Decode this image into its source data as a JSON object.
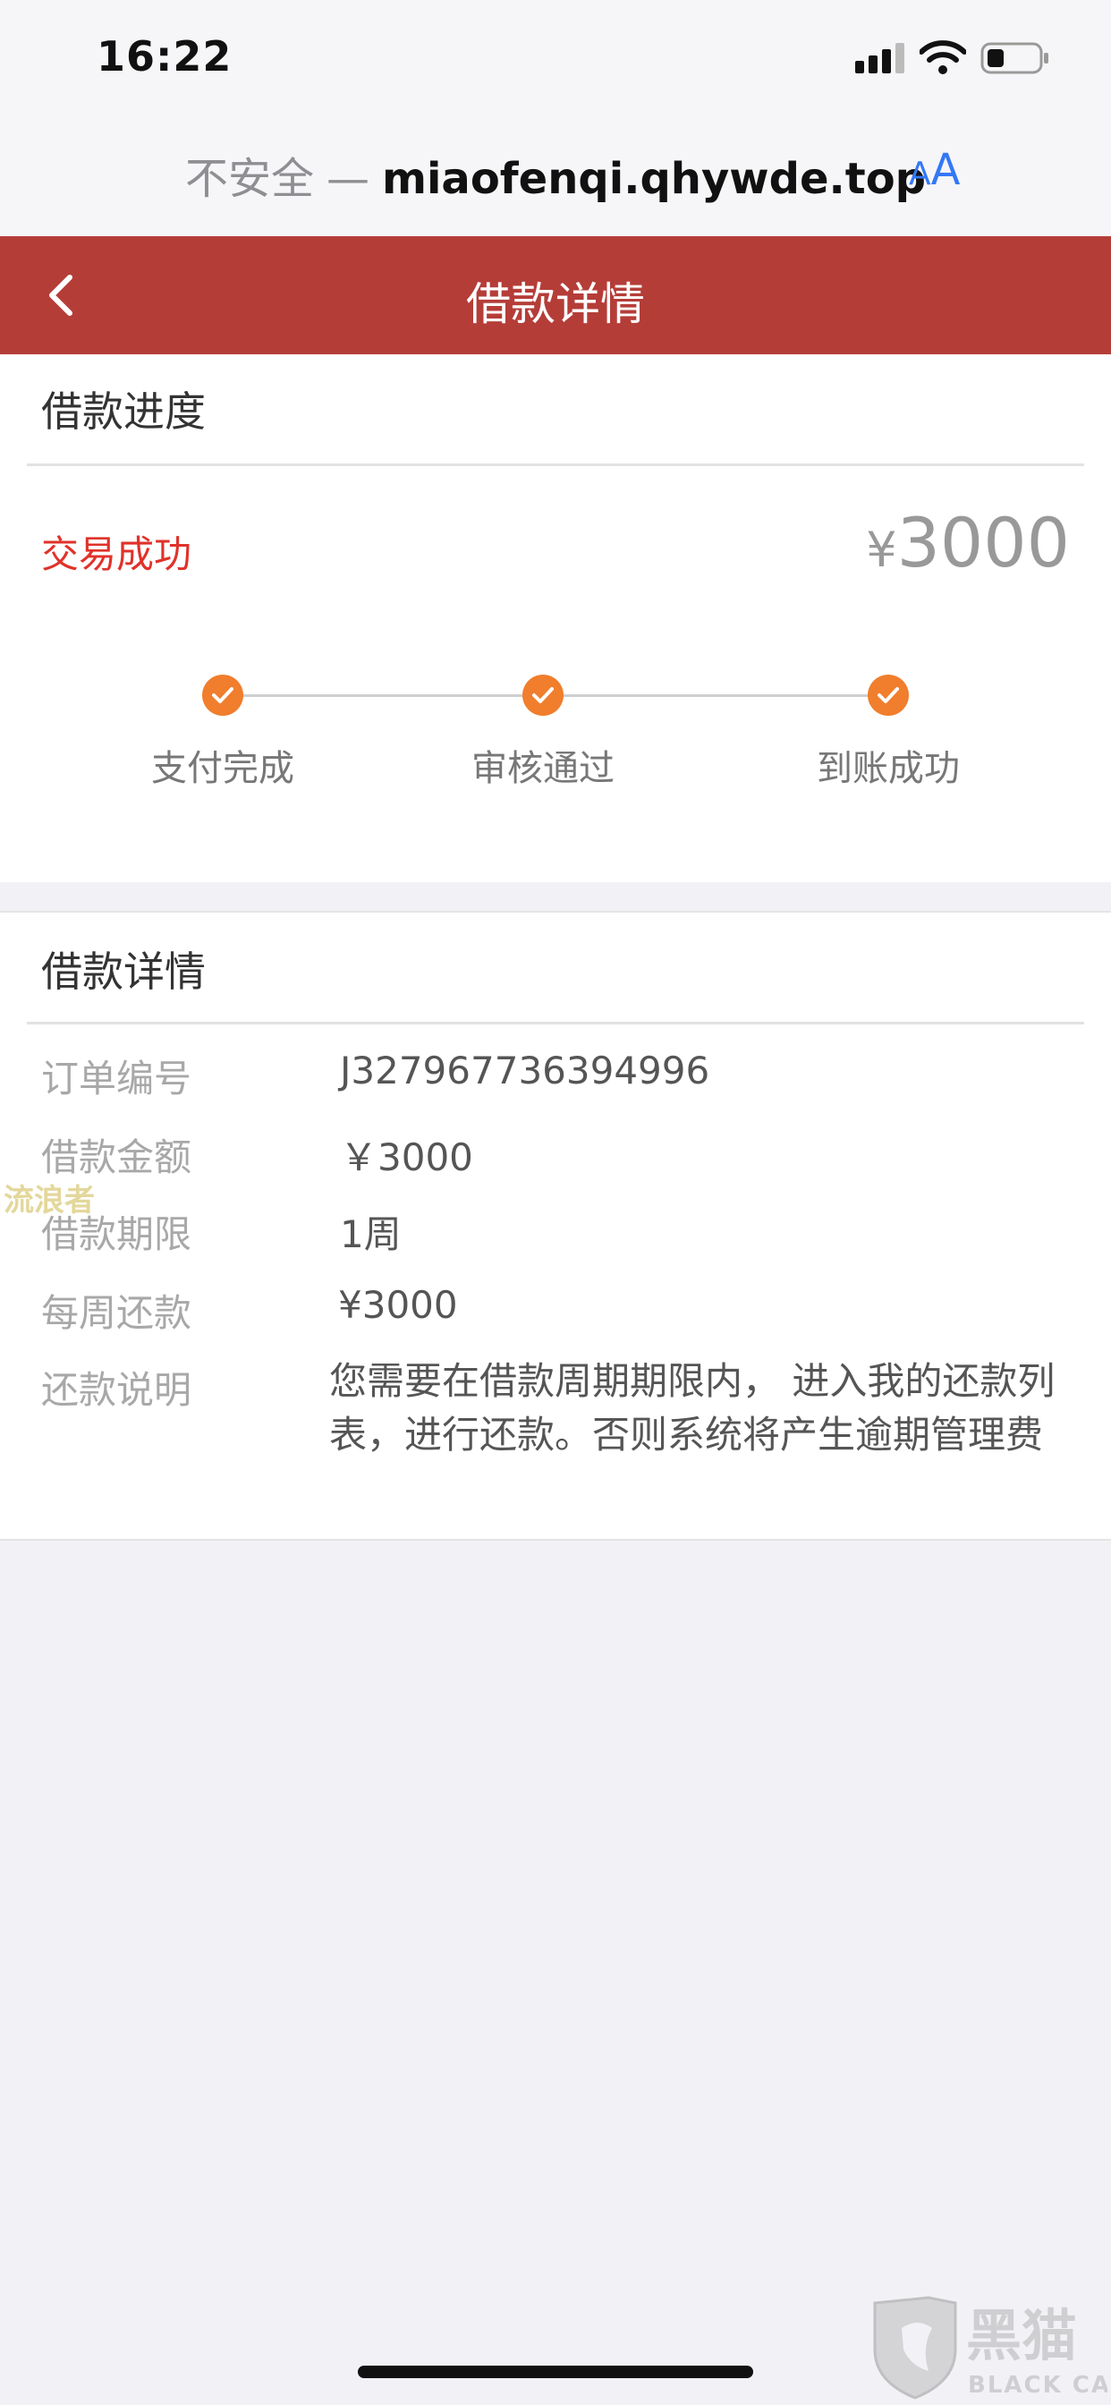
{
  "status_bar": {
    "time": "16:22",
    "icons": [
      "signal-icon",
      "wifi-icon",
      "battery-icon"
    ]
  },
  "url_bar": {
    "warning": "不安全",
    "separator": "—",
    "host": "miaofenqi.qhywde.top",
    "aa_small": "A",
    "aa_large": "A"
  },
  "header": {
    "title": "借款详情",
    "back_icon": "chevron-left-icon"
  },
  "progress": {
    "section_title": "借款进度",
    "status": "交易成功",
    "currency": "¥",
    "amount": "3000",
    "steps": [
      {
        "label": "支付完成",
        "done": true
      },
      {
        "label": "审核通过",
        "done": true
      },
      {
        "label": "到账成功",
        "done": true
      }
    ]
  },
  "details": {
    "section_title": "借款详情",
    "rows": [
      {
        "label": "订单编号",
        "value": "J327967736394996"
      },
      {
        "label": "借款金额",
        "value": "￥3000"
      },
      {
        "label": "借款期限",
        "value": "1周"
      },
      {
        "label": "每周还款",
        "value": "¥3000"
      },
      {
        "label": "还款说明",
        "value": "您需要在借款周期期限内， 进入我的还款列表，进行还款。否则系统将产生逾期管理费"
      }
    ]
  },
  "watermarks": {
    "left": "流浪者",
    "logo": "黑猫 BLACK CAT"
  },
  "colors": {
    "header": "#b53d38",
    "status_success": "#e0322a",
    "step_dot": "#f07e2d",
    "link_blue": "#3478f6",
    "page_bg": "#f2f2f6"
  }
}
